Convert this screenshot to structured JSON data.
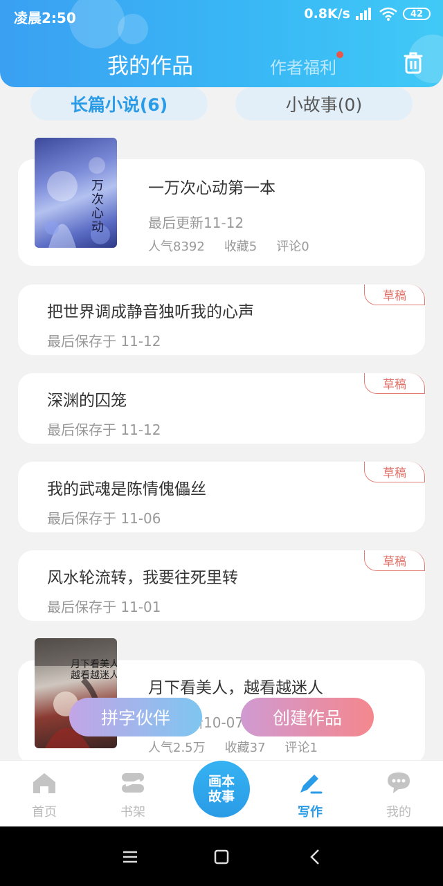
{
  "status_bar": {
    "time": "凌晨2:50",
    "net_speed": "0.8K/s",
    "battery": "42"
  },
  "header": {
    "title": "我的作品",
    "welfare": "作者福利"
  },
  "tabs": {
    "novels": "长篇小说(6)",
    "stories": "小故事(0)"
  },
  "works": [
    {
      "title": "一万次心动第一本",
      "updated": "最后更新11-12",
      "popularity": "人气8392",
      "favorites": "收藏5",
      "comments": "评论0",
      "cover_text": "万次心动"
    }
  ],
  "drafts": [
    {
      "title": "把世界调成静音独听我的心声",
      "saved": "最后保存于 11-12",
      "badge": "草稿"
    },
    {
      "title": "深渊的囚笼",
      "saved": "最后保存于 11-12",
      "badge": "草稿"
    },
    {
      "title": "我的武魂是陈情傀儡丝",
      "saved": "最后保存于 11-06",
      "badge": "草稿"
    },
    {
      "title": "风水轮流转，我要往死里转",
      "saved": "最后保存于 11-01",
      "badge": "草稿"
    }
  ],
  "last_work": {
    "title": "月下看美人，越看越迷人",
    "updated": "最后更新10-07",
    "popularity": "人气2.5万",
    "favorites": "收藏37",
    "comments": "评论1",
    "cover_text": "月下看美人越看越迷人"
  },
  "floating": {
    "partner": "拼字伙伴",
    "create": "创建作品"
  },
  "bottom_nav": {
    "home": "首页",
    "shelf": "书架",
    "center_line1": "画本",
    "center_line2": "故事",
    "write": "写作",
    "me": "我的"
  },
  "colors": {
    "accent": "#2a9be6",
    "draft_badge": "#e0726a"
  }
}
